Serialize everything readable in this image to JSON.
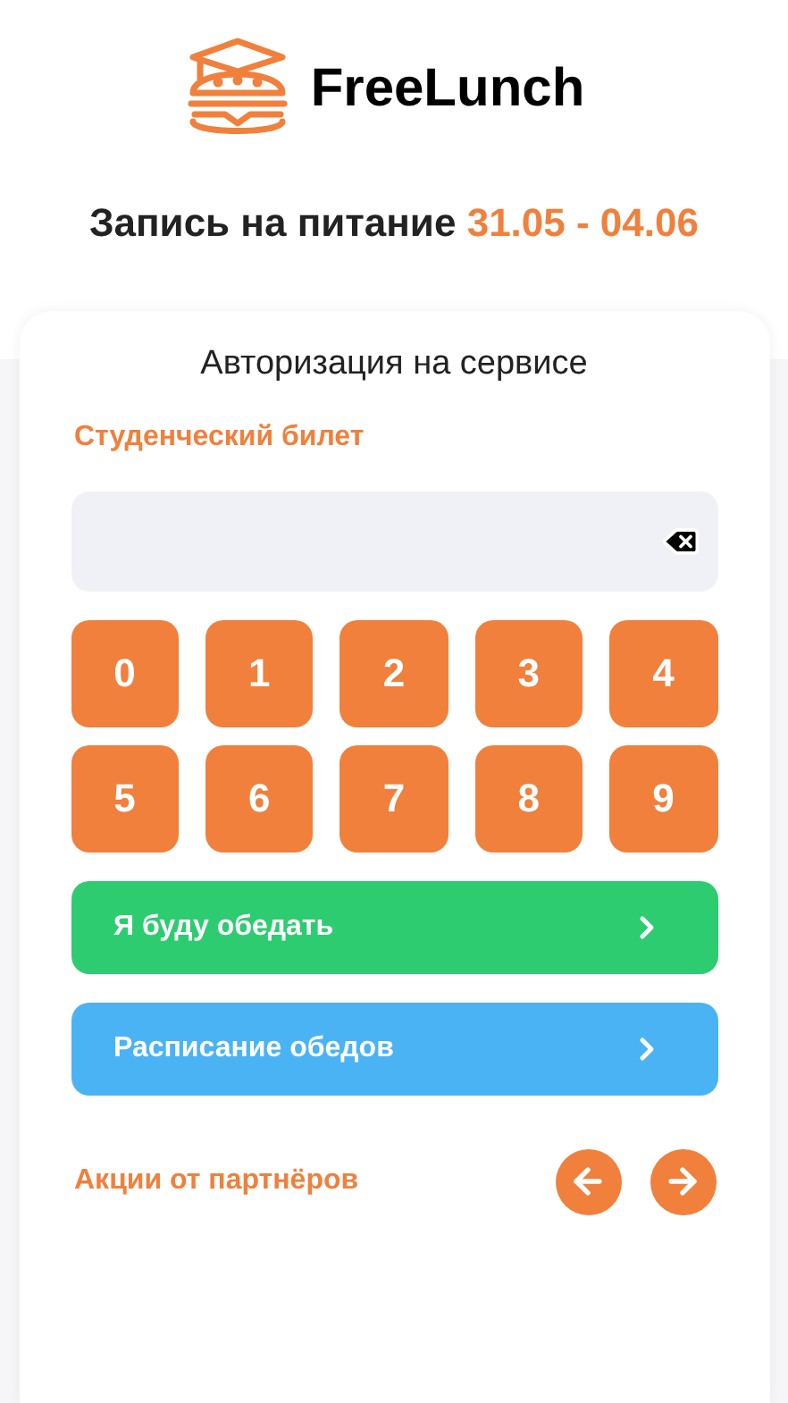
{
  "brand": {
    "name": "FreeLunch"
  },
  "heading": {
    "text": "Запись на питание",
    "dates": "31.05 - 04.06"
  },
  "auth": {
    "title": "Авторизация на сервисе",
    "field_label": "Студенческий билет",
    "keys": [
      "0",
      "1",
      "2",
      "3",
      "4",
      "5",
      "6",
      "7",
      "8",
      "9"
    ],
    "actions": [
      {
        "label": "Я буду обедать",
        "kind": "primary"
      },
      {
        "label": "Расписание обедов",
        "kind": "secondary"
      }
    ],
    "partners": {
      "label": "Акции от партнёров"
    }
  }
}
